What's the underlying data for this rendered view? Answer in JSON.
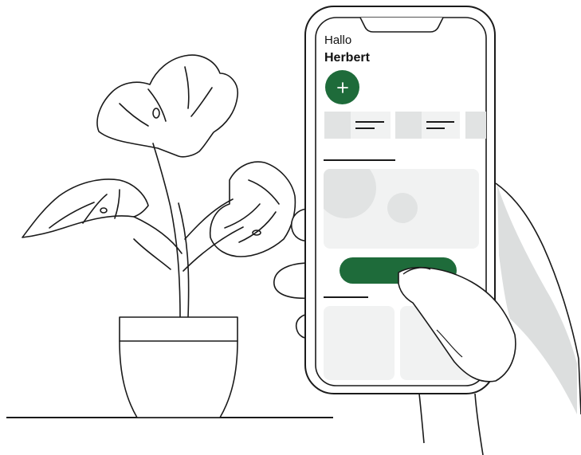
{
  "greeting": {
    "line1": "Hallo",
    "line2": "Herbert"
  },
  "icons": {
    "add": "plus-icon",
    "plant": "monstera-plant-icon",
    "hand": "hand-icon"
  },
  "colors": {
    "accent": "#1e6b3a",
    "placeholder": "#e1e3e3",
    "card": "#f1f2f2",
    "shadow": "#dcdede",
    "line": "#1a1a1a"
  }
}
